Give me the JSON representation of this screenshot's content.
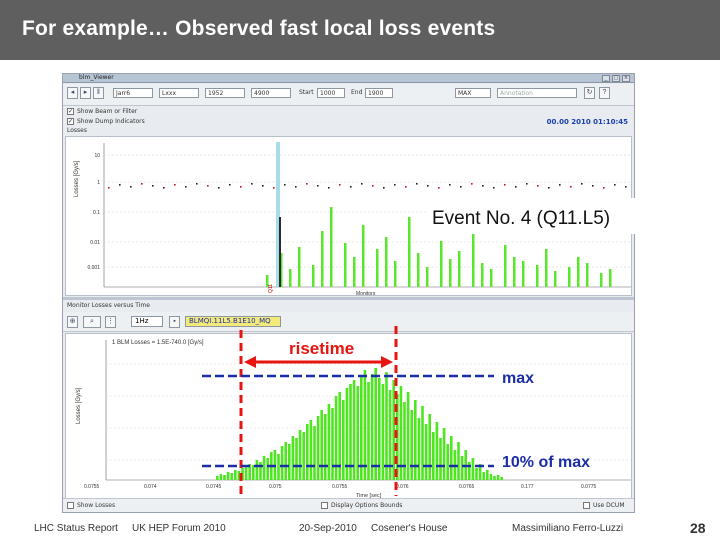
{
  "slide": {
    "title": "For example… Observed fast local loss events"
  },
  "window": {
    "title": "blm_Viewer",
    "min_glyph": "_",
    "max_glyph": "□",
    "close_glyph": "×"
  },
  "toolbar": {
    "dropdown1": "Jarr6",
    "dropdown2": "Lxxx",
    "dropdown3": "1952",
    "dropdown4": "4900",
    "start_label": "Start",
    "start_value": "1000",
    "end_label": "End",
    "end_value": "1900",
    "loss_type": "MAX",
    "filter_placeholder": "Annotation"
  },
  "options": {
    "show_beam_label": "Show Beam or Filter",
    "show_dump_label": "Show Dump Indicators",
    "losses_label": "Losses",
    "timestamp": "00.00 2010 01:10:45"
  },
  "top_plot": {
    "y_ticks": [
      "10",
      "1",
      "0.1",
      "0.01",
      "0.001"
    ],
    "y_label": "Losses [Gy/s]",
    "x_label": "Monitors",
    "marker_label": "Q11"
  },
  "monitor_section": {
    "title": "Monitor Losses versus Time",
    "dropdown": "1Hz",
    "monitor_name": "BLMQI.11L5.B1E10_MQ"
  },
  "bottom_plot": {
    "legend": "1 BLM Losses = 1.5E-740.0 [Gy/s]",
    "y_label": "Losses [Gy/s]",
    "x_label": "Time [sec]",
    "x_ticks": [
      "0.0755",
      "0.074",
      "0.0745",
      "0.075",
      "0.0755",
      "0.076",
      "0.0765",
      "0.177",
      "0.0775"
    ]
  },
  "bottom_bar": {
    "show_losses": "Show Losses",
    "display_option": "Display Options Bounds",
    "use_dcum": "Use DCUM"
  },
  "annotations": {
    "event_label": "Event No. 4 (Q11.L5)",
    "risetime_label": "risetime",
    "max_label": "max",
    "ten_percent_label": "10% of max",
    "red_color": "#e8140f",
    "blue_color": "#1b2ea8"
  },
  "footer": {
    "report": "LHC Status Report",
    "forum": "UK HEP Forum 2010",
    "date": "20-Sep-2010",
    "venue": "Cosener's House",
    "author": "Massimiliano Ferro-Luzzi",
    "page": "28"
  }
}
